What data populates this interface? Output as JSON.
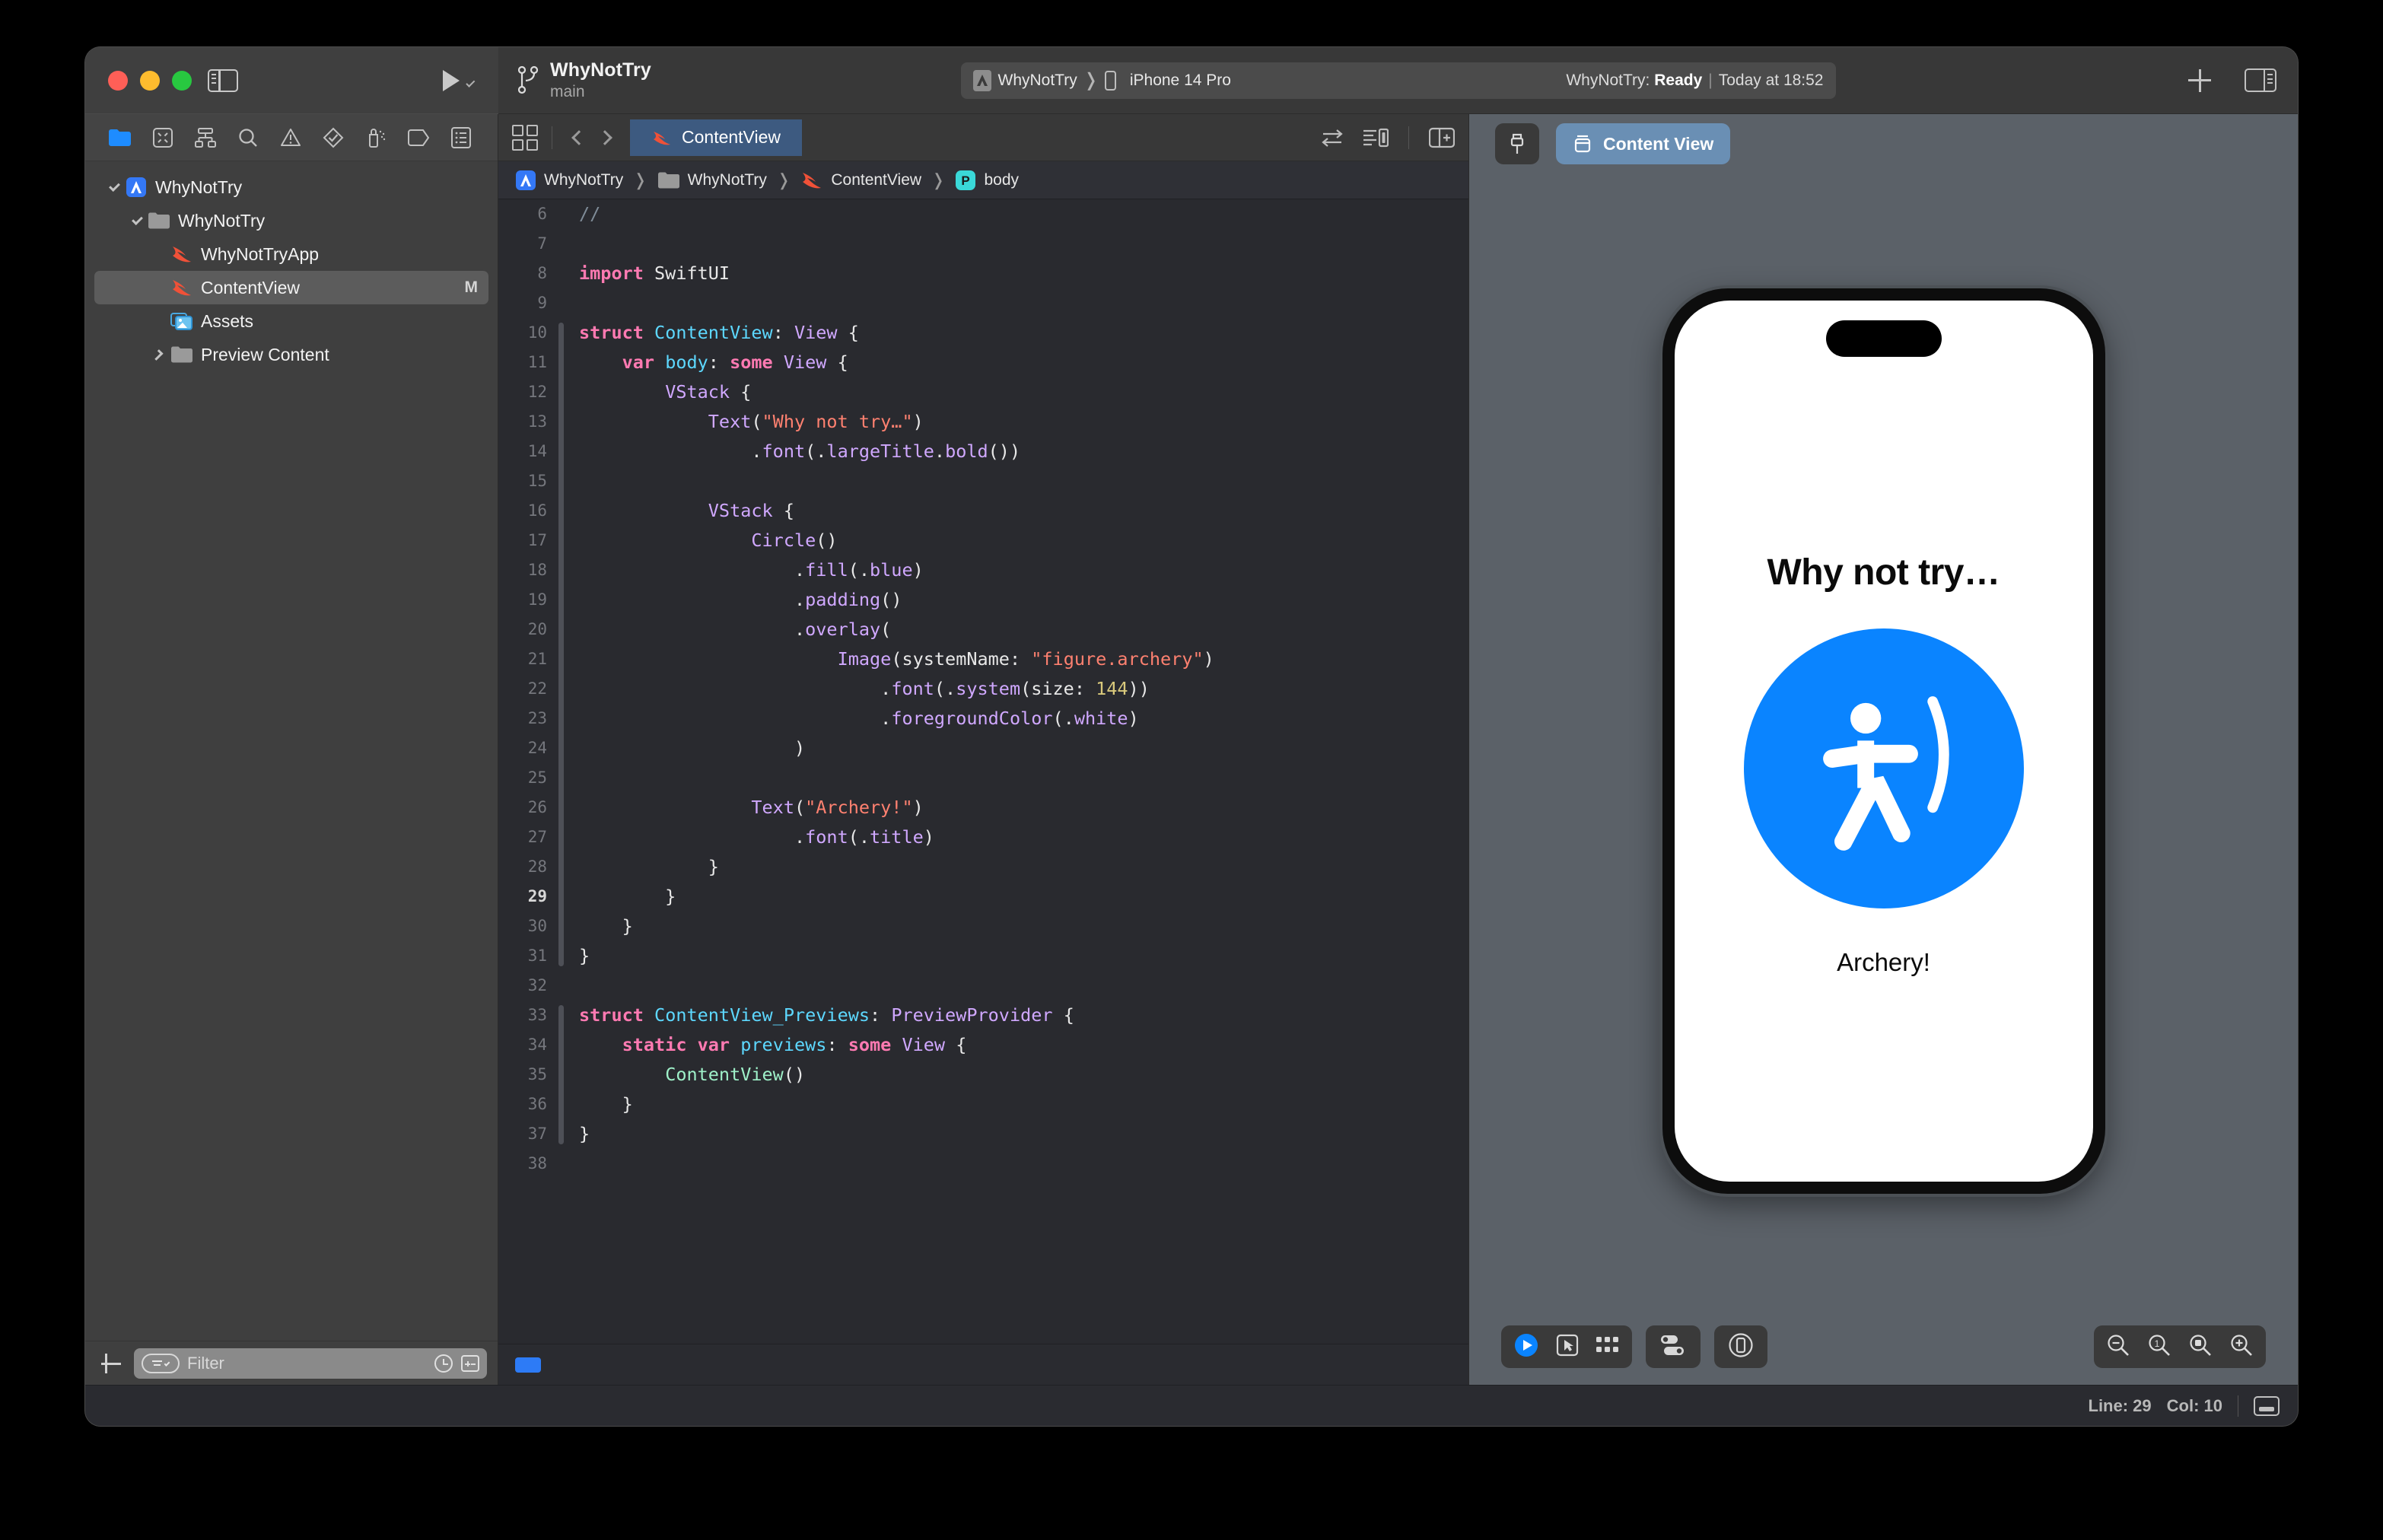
{
  "window": {
    "traffic_lights": [
      "close",
      "minimize",
      "zoom"
    ],
    "sidebar_toggle": "toggle-navigator",
    "run_button": "run",
    "add_button": "+",
    "inspector_toggle": "toggle-inspector"
  },
  "toolbar": {
    "branch_name": "WhyNotTry",
    "branch_sub": "main",
    "scheme": "WhyNotTry",
    "destination": "iPhone 14 Pro",
    "status_prefix": "WhyNotTry:",
    "status_state": "Ready",
    "status_bar_sep": "|",
    "status_time": "Today at 18:52"
  },
  "navigator": {
    "tabs": [
      "project-navigator-icon",
      "source-control-navigator-icon",
      "hierarchy-navigator-icon",
      "find-navigator-icon",
      "issue-navigator-icon",
      "test-navigator-icon",
      "debug-navigator-icon",
      "breakpoint-navigator-icon",
      "report-navigator-icon"
    ],
    "active_tab_index": 0,
    "tree": [
      {
        "label": "WhyNotTry",
        "icon": "xcode-project-icon",
        "depth": 0,
        "disclosure": "down",
        "selected": false,
        "badge": ""
      },
      {
        "label": "WhyNotTry",
        "icon": "folder-icon",
        "depth": 1,
        "disclosure": "down",
        "selected": false,
        "badge": ""
      },
      {
        "label": "WhyNotTryApp",
        "icon": "swift-file-icon",
        "depth": 2,
        "disclosure": "none",
        "selected": false,
        "badge": ""
      },
      {
        "label": "ContentView",
        "icon": "swift-file-icon",
        "depth": 2,
        "disclosure": "none",
        "selected": true,
        "badge": "M"
      },
      {
        "label": "Assets",
        "icon": "assets-catalog-icon",
        "depth": 2,
        "disclosure": "none",
        "selected": false,
        "badge": ""
      },
      {
        "label": "Preview Content",
        "icon": "folder-icon",
        "depth": 2,
        "disclosure": "right",
        "selected": false,
        "badge": ""
      }
    ],
    "filter": {
      "placeholder": "Filter",
      "value": "",
      "add_button": "+",
      "recent_icon": "clock-icon",
      "scope_icon": "filter-scope-icon",
      "adjust_icon": "plus-minus-icon"
    }
  },
  "editor": {
    "tab_label": "ContentView",
    "tab_icon": "swift-file-icon",
    "grid_icon": "editor-options-icon",
    "back_icon": "chevron-left-icon",
    "forward_icon": "chevron-right-icon",
    "right_icons": [
      "related-items-icon",
      "minimap-icon",
      "add-editor-icon"
    ],
    "breadcrumbs": [
      {
        "label": "WhyNotTry",
        "icon": "xcode-project-icon"
      },
      {
        "label": "WhyNotTry",
        "icon": "folder-icon"
      },
      {
        "label": "ContentView",
        "icon": "swift-file-icon"
      },
      {
        "label": "body",
        "icon": "property-symbol-icon"
      }
    ],
    "first_visible_line": 6,
    "current_line": 29,
    "lines": [
      {
        "n": 6,
        "tokens": [
          {
            "t": "//",
            "c": "cm"
          }
        ]
      },
      {
        "n": 7,
        "tokens": []
      },
      {
        "n": 8,
        "tokens": [
          {
            "t": "import",
            "c": "k"
          },
          {
            "t": " SwiftUI",
            "c": "pl"
          }
        ]
      },
      {
        "n": 9,
        "tokens": []
      },
      {
        "n": 10,
        "tokens": [
          {
            "t": "struct",
            "c": "k"
          },
          {
            "t": " ",
            "c": "pl"
          },
          {
            "t": "ContentView",
            "c": "ty"
          },
          {
            "t": ": ",
            "c": "pl"
          },
          {
            "t": "View",
            "c": "pr"
          },
          {
            "t": " {",
            "c": "pl"
          }
        ]
      },
      {
        "n": 11,
        "tokens": [
          {
            "t": "    ",
            "c": "pl"
          },
          {
            "t": "var",
            "c": "k"
          },
          {
            "t": " ",
            "c": "pl"
          },
          {
            "t": "body",
            "c": "ty"
          },
          {
            "t": ": ",
            "c": "pl"
          },
          {
            "t": "some",
            "c": "k"
          },
          {
            "t": " ",
            "c": "pl"
          },
          {
            "t": "View",
            "c": "pr"
          },
          {
            "t": " {",
            "c": "pl"
          }
        ]
      },
      {
        "n": 12,
        "tokens": [
          {
            "t": "        ",
            "c": "pl"
          },
          {
            "t": "VStack",
            "c": "pr"
          },
          {
            "t": " {",
            "c": "pl"
          }
        ]
      },
      {
        "n": 13,
        "tokens": [
          {
            "t": "            ",
            "c": "pl"
          },
          {
            "t": "Text",
            "c": "pr"
          },
          {
            "t": "(",
            "c": "pl"
          },
          {
            "t": "\"Why not try…\"",
            "c": "st"
          },
          {
            "t": ")",
            "c": "pl"
          }
        ]
      },
      {
        "n": 14,
        "tokens": [
          {
            "t": "                .",
            "c": "pl"
          },
          {
            "t": "font",
            "c": "pr"
          },
          {
            "t": "(.",
            "c": "pl"
          },
          {
            "t": "largeTitle",
            "c": "pr"
          },
          {
            "t": ".",
            "c": "pl"
          },
          {
            "t": "bold",
            "c": "pr"
          },
          {
            "t": "())",
            "c": "pl"
          }
        ]
      },
      {
        "n": 15,
        "tokens": []
      },
      {
        "n": 16,
        "tokens": [
          {
            "t": "            ",
            "c": "pl"
          },
          {
            "t": "VStack",
            "c": "pr"
          },
          {
            "t": " {",
            "c": "pl"
          }
        ]
      },
      {
        "n": 17,
        "tokens": [
          {
            "t": "                ",
            "c": "pl"
          },
          {
            "t": "Circle",
            "c": "pr"
          },
          {
            "t": "()",
            "c": "pl"
          }
        ]
      },
      {
        "n": 18,
        "tokens": [
          {
            "t": "                    .",
            "c": "pl"
          },
          {
            "t": "fill",
            "c": "pr"
          },
          {
            "t": "(.",
            "c": "pl"
          },
          {
            "t": "blue",
            "c": "pr"
          },
          {
            "t": ")",
            "c": "pl"
          }
        ]
      },
      {
        "n": 19,
        "tokens": [
          {
            "t": "                    .",
            "c": "pl"
          },
          {
            "t": "padding",
            "c": "pr"
          },
          {
            "t": "()",
            "c": "pl"
          }
        ]
      },
      {
        "n": 20,
        "tokens": [
          {
            "t": "                    .",
            "c": "pl"
          },
          {
            "t": "overlay",
            "c": "pr"
          },
          {
            "t": "(",
            "c": "pl"
          }
        ]
      },
      {
        "n": 21,
        "tokens": [
          {
            "t": "                        ",
            "c": "pl"
          },
          {
            "t": "Image",
            "c": "pr"
          },
          {
            "t": "(systemName: ",
            "c": "pl"
          },
          {
            "t": "\"figure.archery\"",
            "c": "st"
          },
          {
            "t": ")",
            "c": "pl"
          }
        ]
      },
      {
        "n": 22,
        "tokens": [
          {
            "t": "                            .",
            "c": "pl"
          },
          {
            "t": "font",
            "c": "pr"
          },
          {
            "t": "(.",
            "c": "pl"
          },
          {
            "t": "system",
            "c": "pr"
          },
          {
            "t": "(size: ",
            "c": "pl"
          },
          {
            "t": "144",
            "c": "nu"
          },
          {
            "t": "))",
            "c": "pl"
          }
        ]
      },
      {
        "n": 23,
        "tokens": [
          {
            "t": "                            .",
            "c": "pl"
          },
          {
            "t": "foregroundColor",
            "c": "pr"
          },
          {
            "t": "(.",
            "c": "pl"
          },
          {
            "t": "white",
            "c": "pr"
          },
          {
            "t": ")",
            "c": "pl"
          }
        ]
      },
      {
        "n": 24,
        "tokens": [
          {
            "t": "                    )",
            "c": "pl"
          }
        ]
      },
      {
        "n": 25,
        "tokens": []
      },
      {
        "n": 26,
        "tokens": [
          {
            "t": "                ",
            "c": "pl"
          },
          {
            "t": "Text",
            "c": "pr"
          },
          {
            "t": "(",
            "c": "pl"
          },
          {
            "t": "\"Archery!\"",
            "c": "st"
          },
          {
            "t": ")",
            "c": "pl"
          }
        ]
      },
      {
        "n": 27,
        "tokens": [
          {
            "t": "                    .",
            "c": "pl"
          },
          {
            "t": "font",
            "c": "pr"
          },
          {
            "t": "(.",
            "c": "pl"
          },
          {
            "t": "title",
            "c": "pr"
          },
          {
            "t": ")",
            "c": "pl"
          }
        ]
      },
      {
        "n": 28,
        "tokens": [
          {
            "t": "            }",
            "c": "pl"
          }
        ]
      },
      {
        "n": 29,
        "tokens": [
          {
            "t": "        }",
            "c": "pl"
          }
        ]
      },
      {
        "n": 30,
        "tokens": [
          {
            "t": "    }",
            "c": "pl"
          }
        ]
      },
      {
        "n": 31,
        "tokens": [
          {
            "t": "}",
            "c": "pl"
          }
        ]
      },
      {
        "n": 32,
        "tokens": []
      },
      {
        "n": 33,
        "tokens": [
          {
            "t": "struct",
            "c": "k"
          },
          {
            "t": " ",
            "c": "pl"
          },
          {
            "t": "ContentView_Previews",
            "c": "ty"
          },
          {
            "t": ": ",
            "c": "pl"
          },
          {
            "t": "PreviewProvider",
            "c": "pr"
          },
          {
            "t": " {",
            "c": "pl"
          }
        ]
      },
      {
        "n": 34,
        "tokens": [
          {
            "t": "    ",
            "c": "pl"
          },
          {
            "t": "static",
            "c": "k"
          },
          {
            "t": " ",
            "c": "pl"
          },
          {
            "t": "var",
            "c": "k"
          },
          {
            "t": " ",
            "c": "pl"
          },
          {
            "t": "previews",
            "c": "ty"
          },
          {
            "t": ": ",
            "c": "pl"
          },
          {
            "t": "some",
            "c": "k"
          },
          {
            "t": " ",
            "c": "pl"
          },
          {
            "t": "View",
            "c": "pr"
          },
          {
            "t": " {",
            "c": "pl"
          }
        ]
      },
      {
        "n": 35,
        "tokens": [
          {
            "t": "        ",
            "c": "pl"
          },
          {
            "t": "ContentView",
            "c": "tyg"
          },
          {
            "t": "()",
            "c": "pl"
          }
        ]
      },
      {
        "n": 36,
        "tokens": [
          {
            "t": "    }",
            "c": "pl"
          }
        ]
      },
      {
        "n": 37,
        "tokens": [
          {
            "t": "}",
            "c": "pl"
          }
        ]
      },
      {
        "n": 38,
        "tokens": []
      }
    ]
  },
  "canvas": {
    "pin_icon": "pin-icon",
    "preview_pill_label": "Content View",
    "preview_pill_icon": "preview-cube-icon",
    "device": "iPhone 14 Pro",
    "preview": {
      "title": "Why not try…",
      "caption": "Archery!",
      "circle_color": "#0a84ff",
      "symbol": "figure.archery",
      "symbol_color": "#ffffff"
    },
    "controls_left": [
      "live-preview-icon",
      "selectable-preview-icon",
      "variants-preview-icon"
    ],
    "controls_mid": [
      "device-settings-icon"
    ],
    "controls_right_single": [
      "device-bezel-icon"
    ],
    "zoom_controls": [
      "zoom-out-icon",
      "zoom-actual-size-icon",
      "zoom-to-fit-icon",
      "zoom-in-icon"
    ]
  },
  "status_bar": {
    "line_label": "Line: 29",
    "col_label": "Col: 10",
    "debug_area_icon": "debug-area-icon",
    "editor_chip": "build-chip"
  }
}
